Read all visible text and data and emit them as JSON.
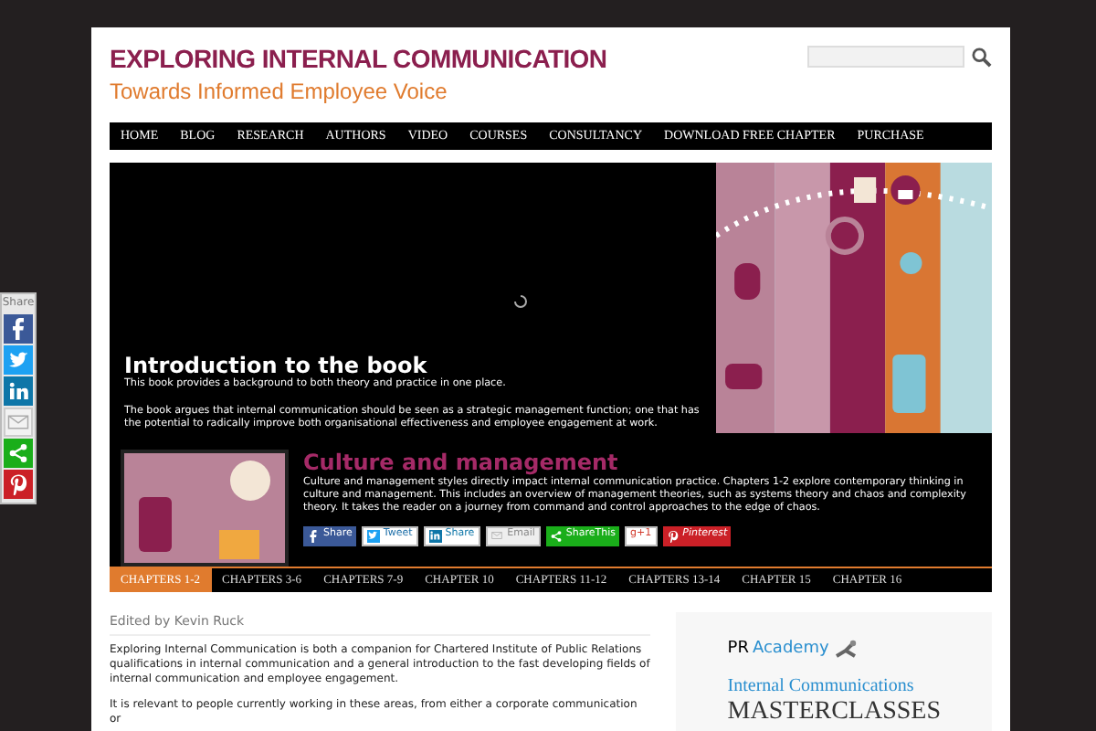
{
  "header": {
    "title": "EXPLORING INTERNAL COMMUNICATION",
    "tagline": "Towards Informed Employee Voice"
  },
  "nav": [
    "HOME",
    "BLOG",
    "RESEARCH",
    "AUTHORS",
    "VIDEO",
    "COURSES",
    "CONSULTANCY",
    "DOWNLOAD FREE CHAPTER",
    "PURCHASE"
  ],
  "slide": {
    "title": "Introduction to the book",
    "paragraphs": [
      "This book provides a background to both theory and practice in one place.",
      "The book argues that internal communication should be seen as a strategic management function; one that has the potential to radically improve both organisational effectiveness and employee engagement at work."
    ]
  },
  "feature": {
    "title": "Culture and management",
    "text": "Culture and management styles directly impact internal communication practice. Chapters 1-2 explore contemporary thinking in culture and management. This includes an overview of management theories, such as systems theory and chaos and complexity theory. It takes the reader on a journey from command and control approaches to the edge of chaos.",
    "share_buttons": [
      {
        "kind": "facebook",
        "label": "Share"
      },
      {
        "kind": "twitter",
        "label": "Tweet"
      },
      {
        "kind": "linkedin",
        "label": "Share"
      },
      {
        "kind": "email",
        "label": "Email"
      },
      {
        "kind": "sharethis",
        "label": "ShareThis"
      },
      {
        "kind": "google",
        "label": "g+1"
      },
      {
        "kind": "pinterest",
        "label": "Pinterest"
      }
    ]
  },
  "chapters": [
    {
      "label": "CHAPTERS 1-2",
      "selected": true
    },
    {
      "label": "CHAPTERS 3-6",
      "selected": false
    },
    {
      "label": "CHAPTERS 7-9",
      "selected": false
    },
    {
      "label": "CHAPTER 10",
      "selected": false
    },
    {
      "label": "CHAPTERS 11-12",
      "selected": false
    },
    {
      "label": "CHAPTERS 13-14",
      "selected": false
    },
    {
      "label": "CHAPTER 15",
      "selected": false
    },
    {
      "label": "CHAPTER 16",
      "selected": false
    }
  ],
  "content": {
    "byline": "Edited by Kevin Ruck",
    "paragraphs": [
      "Exploring Internal Communication is both a companion for Chartered Institute of Public Relations qualifications in internal communication and a general introduction to the fast developing fields of internal communication and employee engagement.",
      "It is relevant to people currently working in these areas, from either a corporate communication or"
    ]
  },
  "sidebar_ad": {
    "brand_prefix": "PR",
    "brand": "Academy",
    "heading": "Internal Communications",
    "subheading": "MASTERCLASSES"
  },
  "floating_share": {
    "label": "Share",
    "buttons": [
      {
        "kind": "facebook"
      },
      {
        "kind": "twitter"
      },
      {
        "kind": "linkedin"
      },
      {
        "kind": "email"
      },
      {
        "kind": "sharethis"
      },
      {
        "kind": "pinterest"
      }
    ]
  }
}
